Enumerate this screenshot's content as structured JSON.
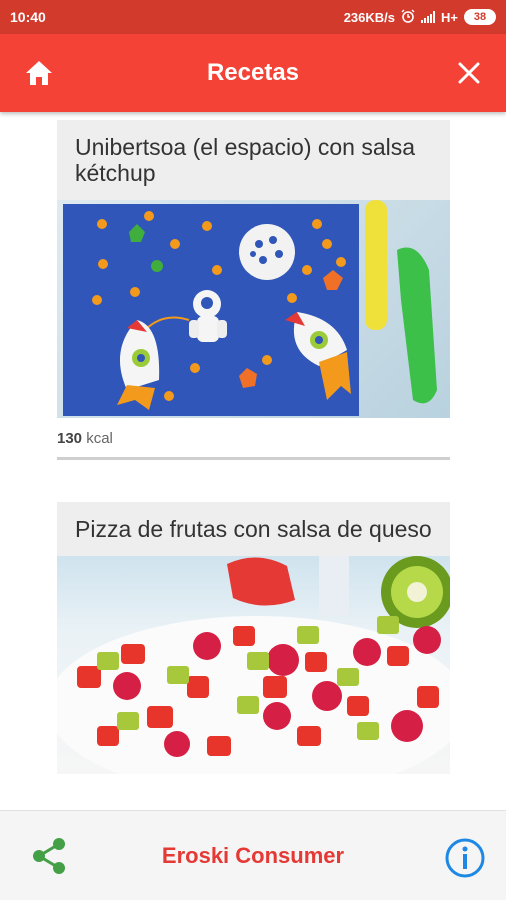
{
  "status_bar": {
    "time": "10:40",
    "network_speed": "236KB/s",
    "network_type": "H+",
    "battery": "38",
    "icons": [
      "alarm-icon",
      "signal-icon",
      "battery-icon"
    ]
  },
  "app_bar": {
    "title": "Recetas",
    "left_icon": "home-icon",
    "right_icon": "close-icon",
    "background_color": "#f44336"
  },
  "recipes": [
    {
      "title": "Unibertsoa (el espacio) con salsa kétchup",
      "kcal_value": "130",
      "kcal_unit": "kcal"
    },
    {
      "title": "Pizza de frutas con salsa de queso"
    }
  ],
  "bottom_bar": {
    "brand": "Eroski Consumer",
    "left_icon": "share-icon",
    "right_icon": "info-icon",
    "brand_color": "#e53935",
    "share_color": "#43a047",
    "info_color": "#1e88e5"
  }
}
